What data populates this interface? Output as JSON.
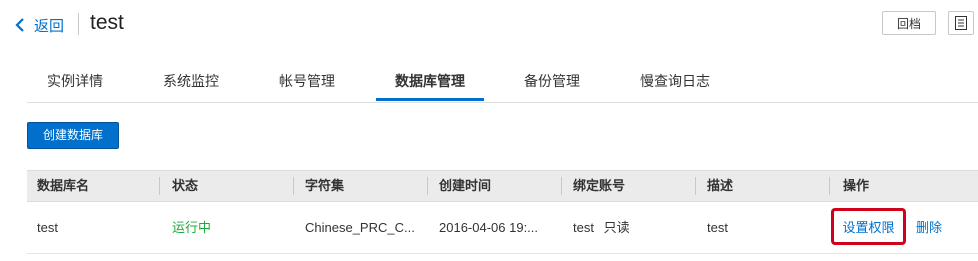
{
  "header": {
    "back_label": "返回",
    "title": "test",
    "rollback_label": "回档"
  },
  "tabs": [
    {
      "label": "实例详情"
    },
    {
      "label": "系统监控"
    },
    {
      "label": "帐号管理"
    },
    {
      "label": "数据库管理",
      "active": true
    },
    {
      "label": "备份管理"
    },
    {
      "label": "慢查询日志"
    }
  ],
  "toolbar": {
    "create_label": "创建数据库"
  },
  "table": {
    "columns": [
      "数据库名",
      "状态",
      "字符集",
      "创建时间",
      "绑定账号",
      "描述",
      "操作"
    ],
    "rows": [
      {
        "name": "test",
        "status": "运行中",
        "charset": "Chinese_PRC_C...",
        "created": "2016-04-06 19:...",
        "account": "test",
        "account_perm": "只读",
        "desc": "test",
        "action_permission": "设置权限",
        "action_delete": "删除"
      }
    ]
  },
  "colors": {
    "accent": "#0070cc",
    "status_running": "#1cab3b",
    "highlight": "#d0021b"
  },
  "icons": {
    "back": "chevron-left-icon",
    "menu": "list-icon"
  }
}
